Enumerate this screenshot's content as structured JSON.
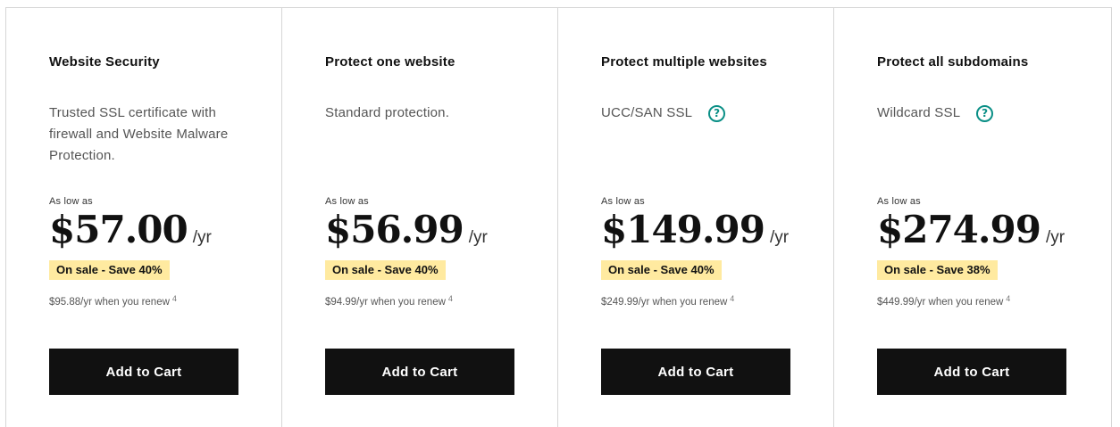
{
  "plans": [
    {
      "title": "Website Security",
      "description": "Trusted SSL certificate with firewall and Website Malware Protection.",
      "has_help_icon": false,
      "as_low_as": "As low as",
      "price": "$57.00",
      "period": "/yr",
      "sale_badge": "On sale - Save 40%",
      "renewal": "$95.88/yr when you renew",
      "footnote": "4",
      "cta": "Add to Cart"
    },
    {
      "title": "Protect one website",
      "description": "Standard protection.",
      "has_help_icon": false,
      "as_low_as": "As low as",
      "price": "$56.99",
      "period": "/yr",
      "sale_badge": "On sale - Save 40%",
      "renewal": "$94.99/yr when you renew",
      "footnote": "4",
      "cta": "Add to Cart"
    },
    {
      "title": "Protect multiple websites",
      "description": "UCC/SAN SSL",
      "has_help_icon": true,
      "help_icon": "question-circle-icon",
      "as_low_as": "As low as",
      "price": "$149.99",
      "period": "/yr",
      "sale_badge": "On sale - Save 40%",
      "renewal": "$249.99/yr when you renew",
      "footnote": "4",
      "cta": "Add to Cart"
    },
    {
      "title": "Protect all subdomains",
      "description": "Wildcard SSL",
      "has_help_icon": true,
      "help_icon": "question-circle-icon",
      "as_low_as": "As low as",
      "price": "$274.99",
      "period": "/yr",
      "sale_badge": "On sale - Save 38%",
      "renewal": "$449.99/yr when you renew",
      "footnote": "4",
      "cta": "Add to Cart"
    }
  ],
  "help_glyph": "?",
  "colors": {
    "badge_bg": "#ffeaa0",
    "button_bg": "#111111",
    "help_icon": "#0a8f86",
    "border": "#d6d6d6"
  }
}
